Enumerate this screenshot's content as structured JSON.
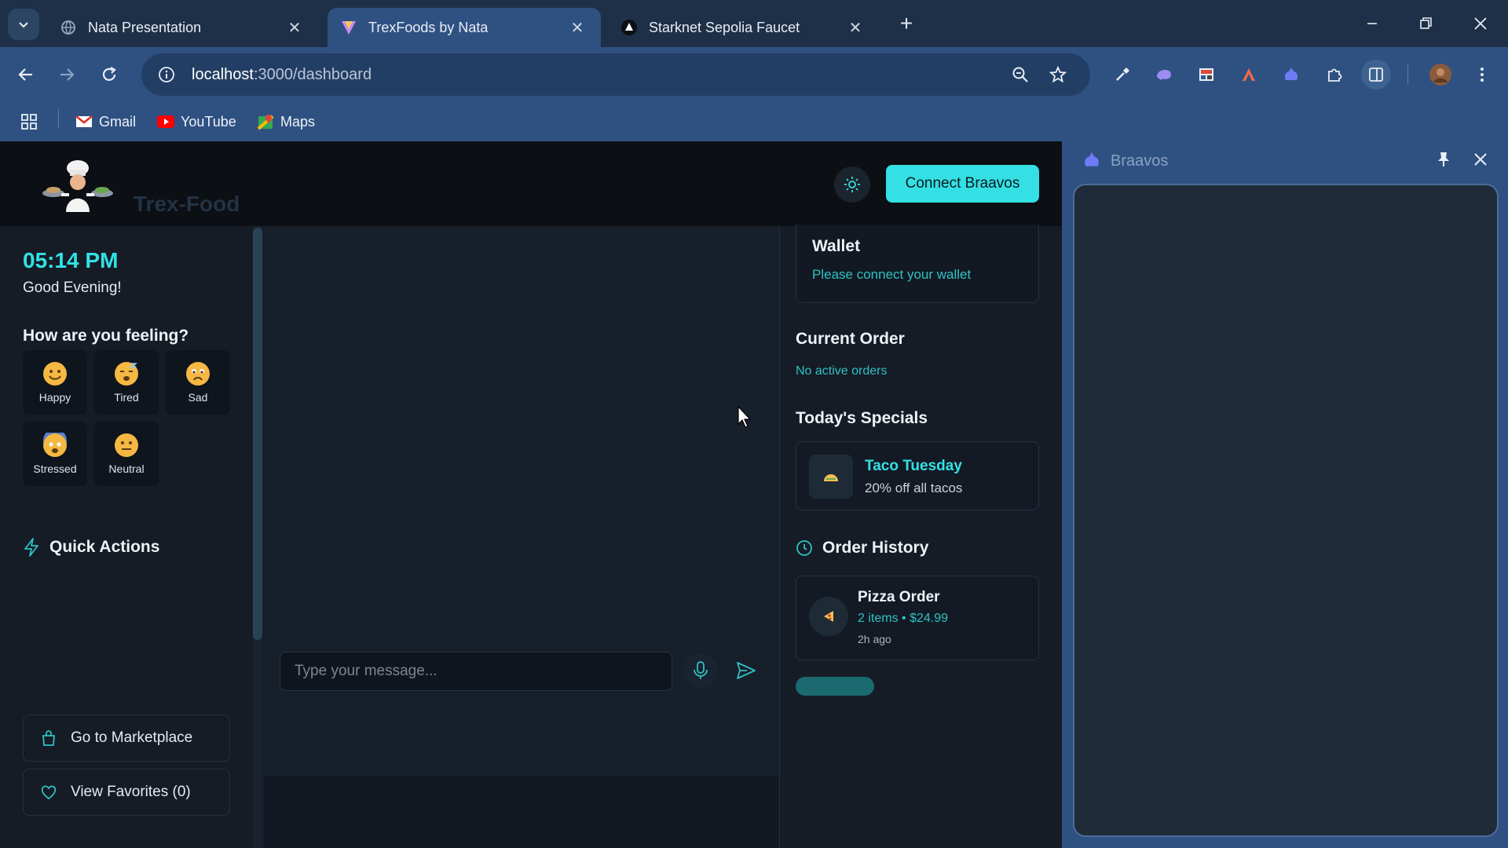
{
  "browser": {
    "tabs": [
      {
        "title": "Nata Presentation",
        "active": false
      },
      {
        "title": "TrexFoods by Nata",
        "active": true
      },
      {
        "title": "Starknet Sepolia Faucet",
        "active": false
      }
    ],
    "address": {
      "host": "localhost",
      "path": ":3000/dashboard"
    },
    "bookmarks": [
      {
        "label": "Gmail"
      },
      {
        "label": "YouTube"
      },
      {
        "label": "Maps"
      }
    ]
  },
  "app": {
    "brand": "Trex-Food",
    "connect_label": "Connect Braavos",
    "sidebar": {
      "time": "05:14 PM",
      "greeting": "Good Evening!",
      "feeling_title": "How are you feeling?",
      "moods": [
        {
          "label": "Happy"
        },
        {
          "label": "Tired"
        },
        {
          "label": "Sad"
        },
        {
          "label": "Stressed"
        },
        {
          "label": "Neutral"
        }
      ],
      "quick_actions_title": "Quick Actions",
      "actions": [
        {
          "label": "Go to Marketplace"
        },
        {
          "label": "View Favorites (0)"
        }
      ]
    },
    "chat": {
      "placeholder": "Type your message..."
    },
    "right": {
      "wallet_title": "Wallet",
      "wallet_status": "Please connect your wallet",
      "current_order_title": "Current Order",
      "current_order_status": "No active orders",
      "specials_title": "Today's Specials",
      "special": {
        "name": "Taco Tuesday",
        "desc": "20% off all tacos"
      },
      "history_title": "Order History",
      "history_item": {
        "name": "Pizza Order",
        "detail": "2 items • $24.99",
        "time": "2h ago"
      }
    }
  },
  "side_panel": {
    "title": "Braavos"
  },
  "colors": {
    "accent": "#34e0e3",
    "chrome": "#2f5182"
  }
}
